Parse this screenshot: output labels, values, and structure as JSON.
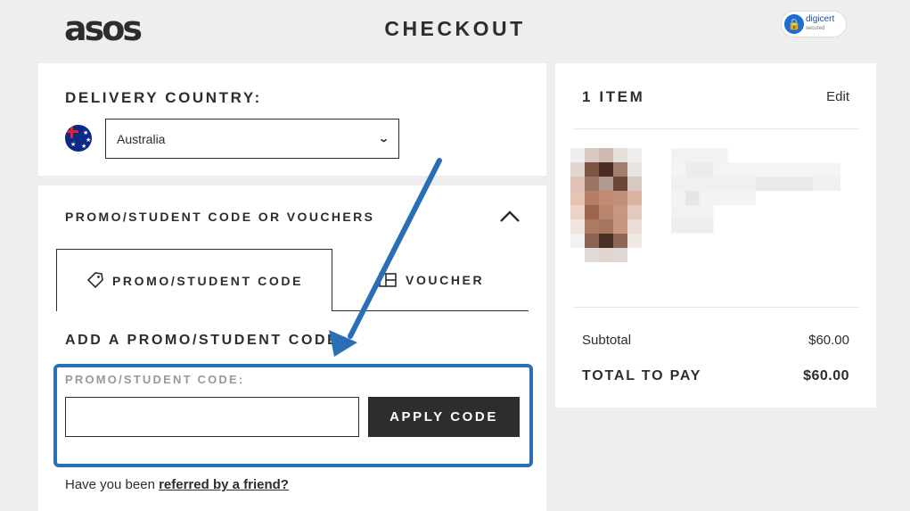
{
  "header": {
    "logo": "asos",
    "title": "CHECKOUT",
    "trust_badge": {
      "name": "digicert",
      "sub": "secured",
      "icon": "lock-icon"
    }
  },
  "delivery": {
    "title": "DELIVERY COUNTRY:",
    "country": "Australia",
    "flag_icon": "australia-flag-icon"
  },
  "promo": {
    "section_title": "PROMO/STUDENT CODE OR VOUCHERS",
    "tabs": [
      {
        "label": "PROMO/STUDENT CODE",
        "icon": "tag-icon",
        "active": true
      },
      {
        "label": "VOUCHER",
        "icon": "voucher-icon",
        "active": false
      }
    ],
    "add_title": "ADD A PROMO/STUDENT CODE",
    "field_label": "PROMO/STUDENT CODE:",
    "input_value": "",
    "apply_label": "APPLY CODE",
    "referral_text": "Have you been ",
    "referral_link": "referred by a friend?",
    "highlight_color": "#2a6fb5"
  },
  "summary": {
    "items_title": "1 ITEM",
    "edit_label": "Edit",
    "subtotal_label": "Subtotal",
    "subtotal_value": "$60.00",
    "total_label": "TOTAL TO PAY",
    "total_value": "$60.00"
  },
  "colors": {
    "background": "#eeeeee",
    "panel": "#ffffff",
    "text": "#2d2d2d",
    "annotation_blue": "#2a6fb5"
  }
}
